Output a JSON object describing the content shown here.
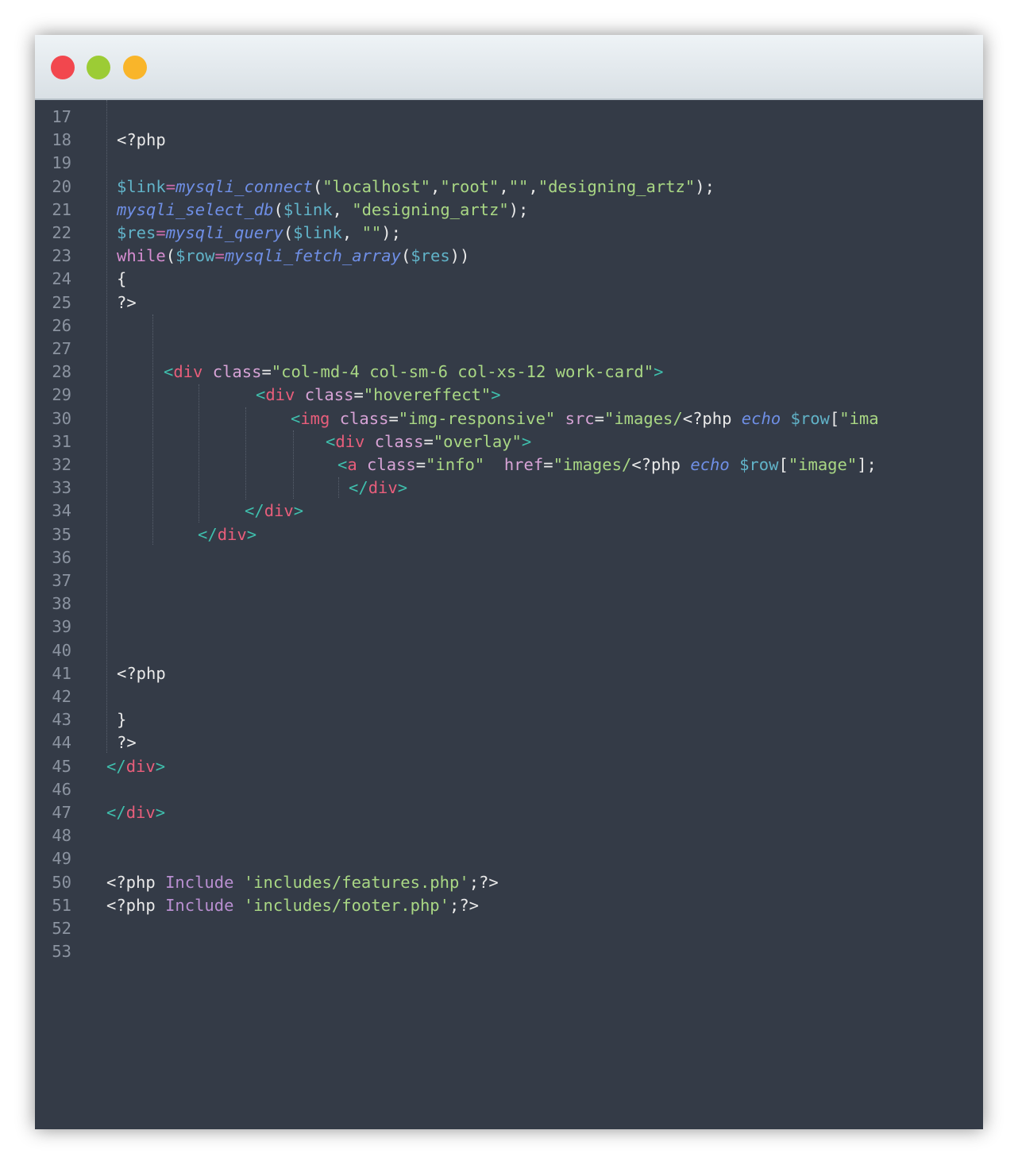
{
  "window": {
    "controls": [
      "close",
      "minimize",
      "maximize"
    ],
    "colors": {
      "close": "#f2474e",
      "minimize": "#9ccc35",
      "maximize": "#f9b52a",
      "background": "#343b47"
    }
  },
  "editor": {
    "language": "php",
    "lines": [
      {
        "n": "17",
        "tokens": []
      },
      {
        "n": "18",
        "tokens": [
          [
            "php",
            "<?php"
          ]
        ]
      },
      {
        "n": "19",
        "tokens": []
      },
      {
        "n": "20",
        "tokens": [
          [
            "var",
            "$link"
          ],
          [
            "op",
            "="
          ],
          [
            "fn",
            "mysqli_connect"
          ],
          [
            "p",
            "("
          ],
          [
            "str",
            "\"localhost\""
          ],
          [
            "p",
            ","
          ],
          [
            "str",
            "\"root\""
          ],
          [
            "p",
            ","
          ],
          [
            "str",
            "\"\""
          ],
          [
            "p",
            ","
          ],
          [
            "str",
            "\"designing_artz\""
          ],
          [
            "p",
            ");"
          ]
        ]
      },
      {
        "n": "21",
        "tokens": [
          [
            "fn",
            "mysqli_select_db"
          ],
          [
            "p",
            "("
          ],
          [
            "var",
            "$link"
          ],
          [
            "p",
            ", "
          ],
          [
            "str",
            "\"designing_artz\""
          ],
          [
            "p",
            ");"
          ]
        ]
      },
      {
        "n": "22",
        "tokens": [
          [
            "var",
            "$res"
          ],
          [
            "op",
            "="
          ],
          [
            "fn",
            "mysqli_query"
          ],
          [
            "p",
            "("
          ],
          [
            "var",
            "$link"
          ],
          [
            "p",
            ", "
          ],
          [
            "str",
            "\"\""
          ],
          [
            "p",
            ");"
          ]
        ]
      },
      {
        "n": "23",
        "tokens": [
          [
            "kw",
            "while"
          ],
          [
            "p",
            "("
          ],
          [
            "var",
            "$row"
          ],
          [
            "op",
            "="
          ],
          [
            "fn",
            "mysqli_fetch_array"
          ],
          [
            "p",
            "("
          ],
          [
            "var",
            "$res"
          ],
          [
            "p",
            "))"
          ]
        ]
      },
      {
        "n": "24",
        "tokens": [
          [
            "p",
            "{"
          ]
        ]
      },
      {
        "n": "25",
        "tokens": [
          [
            "php",
            "?>"
          ]
        ]
      },
      {
        "n": "26",
        "tokens": []
      },
      {
        "n": "27",
        "tokens": []
      },
      {
        "n": "28",
        "tokens": [
          [
            "ang",
            "<"
          ],
          [
            "tag",
            "div"
          ],
          [
            "p",
            " "
          ],
          [
            "attr",
            "class"
          ],
          [
            "p",
            "="
          ],
          [
            "str",
            "\"col-md-4 col-sm-6 col-xs-12 work-card\""
          ],
          [
            "ang",
            ">"
          ]
        ]
      },
      {
        "n": "29",
        "tokens": [
          [
            "ang",
            "<"
          ],
          [
            "tag",
            "div"
          ],
          [
            "p",
            " "
          ],
          [
            "attr",
            "class"
          ],
          [
            "p",
            "="
          ],
          [
            "str",
            "\"hovereffect\""
          ],
          [
            "ang",
            ">"
          ]
        ]
      },
      {
        "n": "30",
        "tokens": [
          [
            "ang",
            "<"
          ],
          [
            "tag",
            "img"
          ],
          [
            "p",
            " "
          ],
          [
            "attr",
            "class"
          ],
          [
            "p",
            "="
          ],
          [
            "str",
            "\"img-responsive\""
          ],
          [
            "p",
            " "
          ],
          [
            "attr",
            "src"
          ],
          [
            "p",
            "="
          ],
          [
            "str",
            "\"images/"
          ],
          [
            "php",
            "<?php "
          ],
          [
            "echo",
            "echo"
          ],
          [
            "p",
            " "
          ],
          [
            "var",
            "$row"
          ],
          [
            "p",
            "["
          ],
          [
            "str",
            "\"ima"
          ]
        ]
      },
      {
        "n": "31",
        "tokens": [
          [
            "ang",
            "<"
          ],
          [
            "tag",
            "div"
          ],
          [
            "p",
            " "
          ],
          [
            "attr",
            "class"
          ],
          [
            "p",
            "="
          ],
          [
            "str",
            "\"overlay\""
          ],
          [
            "ang",
            ">"
          ]
        ]
      },
      {
        "n": "32",
        "tokens": [
          [
            "ang",
            "<"
          ],
          [
            "tag",
            "a"
          ],
          [
            "p",
            " "
          ],
          [
            "attr",
            "class"
          ],
          [
            "p",
            "="
          ],
          [
            "str",
            "\"info\""
          ],
          [
            "p",
            "  "
          ],
          [
            "attr",
            "href"
          ],
          [
            "p",
            "="
          ],
          [
            "str",
            "\"images/"
          ],
          [
            "php",
            "<?php "
          ],
          [
            "echo",
            "echo"
          ],
          [
            "p",
            " "
          ],
          [
            "var",
            "$row"
          ],
          [
            "p",
            "["
          ],
          [
            "str",
            "\"image\""
          ],
          [
            "p",
            "];"
          ]
        ]
      },
      {
        "n": "33",
        "tokens": [
          [
            "ang",
            "</"
          ],
          [
            "tag",
            "div"
          ],
          [
            "ang",
            ">"
          ]
        ]
      },
      {
        "n": "34",
        "tokens": [
          [
            "ang",
            "</"
          ],
          [
            "tag",
            "div"
          ],
          [
            "ang",
            ">"
          ]
        ]
      },
      {
        "n": "35",
        "tokens": [
          [
            "ang",
            "</"
          ],
          [
            "tag",
            "div"
          ],
          [
            "ang",
            ">"
          ]
        ]
      },
      {
        "n": "36",
        "tokens": []
      },
      {
        "n": "37",
        "tokens": []
      },
      {
        "n": "38",
        "tokens": []
      },
      {
        "n": "39",
        "tokens": []
      },
      {
        "n": "40",
        "tokens": []
      },
      {
        "n": "41",
        "tokens": [
          [
            "php",
            "<?php"
          ]
        ]
      },
      {
        "n": "42",
        "tokens": []
      },
      {
        "n": "43",
        "tokens": [
          [
            "p",
            "}"
          ]
        ]
      },
      {
        "n": "44",
        "tokens": [
          [
            "php",
            "?>"
          ]
        ]
      },
      {
        "n": "45",
        "tokens": [
          [
            "ang",
            "</"
          ],
          [
            "tag",
            "div"
          ],
          [
            "ang",
            ">"
          ]
        ]
      },
      {
        "n": "46",
        "tokens": []
      },
      {
        "n": "47",
        "tokens": [
          [
            "ang",
            "</"
          ],
          [
            "tag",
            "div"
          ],
          [
            "ang",
            ">"
          ]
        ]
      },
      {
        "n": "48",
        "tokens": []
      },
      {
        "n": "49",
        "tokens": []
      },
      {
        "n": "50",
        "tokens": [
          [
            "php",
            "<?php "
          ],
          [
            "inc",
            "Include"
          ],
          [
            "p",
            " "
          ],
          [
            "str",
            "'includes/features.php'"
          ],
          [
            "p",
            ";"
          ],
          [
            "php",
            "?>"
          ]
        ]
      },
      {
        "n": "51",
        "tokens": [
          [
            "php",
            "<?php "
          ],
          [
            "inc",
            "Include"
          ],
          [
            "p",
            " "
          ],
          [
            "str",
            "'includes/footer.php'"
          ],
          [
            "p",
            ";"
          ],
          [
            "php",
            "?>"
          ]
        ]
      },
      {
        "n": "52",
        "tokens": []
      },
      {
        "n": "53",
        "tokens": []
      }
    ]
  }
}
